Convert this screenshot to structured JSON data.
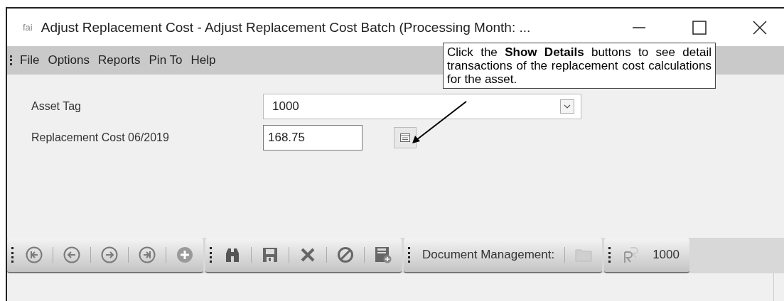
{
  "window": {
    "app_label": "fai",
    "title": "Adjust Replacement Cost - Adjust Replacement Cost Batch  (Processing Month: ..."
  },
  "menu": [
    {
      "label": "File"
    },
    {
      "label": "Options"
    },
    {
      "label": "Reports"
    },
    {
      "label": "Pin To"
    },
    {
      "label": "Help"
    }
  ],
  "form": {
    "fields": [
      {
        "kind": "combo",
        "label": "Asset Tag",
        "value": "1000"
      },
      {
        "kind": "text",
        "label": "Replacement Cost 06/2019",
        "value": "168.75",
        "details_button": true
      }
    ]
  },
  "callout": {
    "text": "Click the **Show Details** buttons to see detail transactions of the replacement cost calculations for the asset."
  },
  "toolbar": {
    "groups": [
      {
        "items": [
          {
            "kind": "first"
          },
          {
            "kind": "prev"
          },
          {
            "kind": "next"
          },
          {
            "kind": "last"
          },
          {
            "kind": "add"
          }
        ]
      },
      {
        "items": [
          {
            "kind": "find"
          },
          {
            "kind": "save"
          },
          {
            "kind": "delete"
          },
          {
            "kind": "cancel"
          },
          {
            "kind": "save_new"
          }
        ]
      },
      {
        "items": [
          {
            "kind": "label",
            "text": "Document Management:"
          },
          {
            "kind": "folder"
          }
        ]
      },
      {
        "items": [
          {
            "kind": "record"
          },
          {
            "kind": "label",
            "text": "1000"
          }
        ]
      }
    ]
  }
}
